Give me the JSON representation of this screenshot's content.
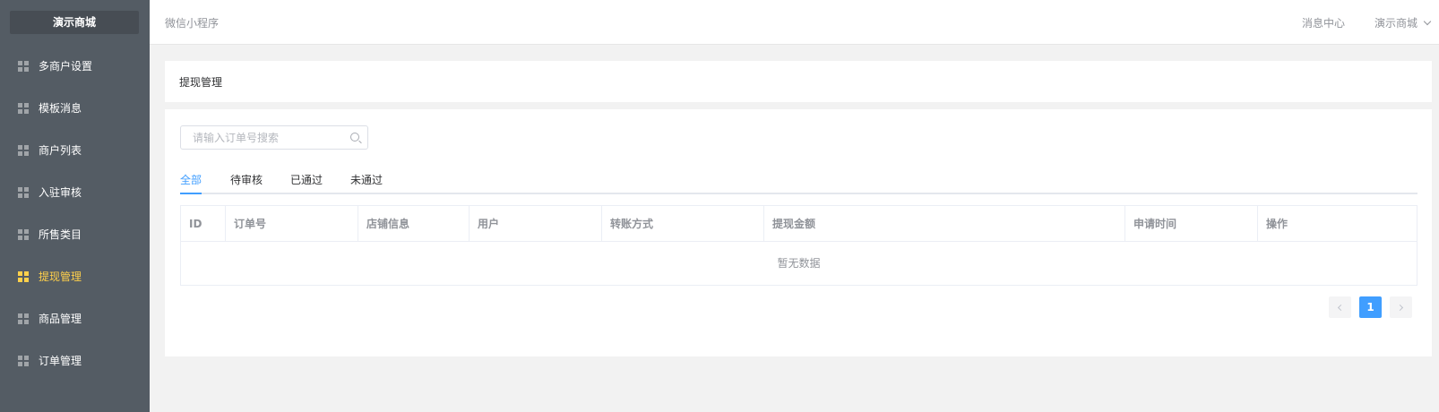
{
  "brand": "演示商城",
  "sidebar": {
    "items": [
      {
        "label": "多商户设置",
        "active": false
      },
      {
        "label": "模板消息",
        "active": false
      },
      {
        "label": "商户列表",
        "active": false
      },
      {
        "label": "入驻审核",
        "active": false
      },
      {
        "label": "所售类目",
        "active": false
      },
      {
        "label": "提现管理",
        "active": true
      },
      {
        "label": "商品管理",
        "active": false
      },
      {
        "label": "订单管理",
        "active": false
      }
    ]
  },
  "header": {
    "title": "微信小程序",
    "messages": "消息中心",
    "user": "演示商城"
  },
  "page": {
    "title": "提现管理"
  },
  "search": {
    "placeholder": "请输入订单号搜索"
  },
  "tabs": [
    {
      "label": "全部",
      "active": true
    },
    {
      "label": "待审核",
      "active": false
    },
    {
      "label": "已通过",
      "active": false
    },
    {
      "label": "未通过",
      "active": false
    }
  ],
  "table": {
    "columns": [
      "ID",
      "订单号",
      "店铺信息",
      "用户",
      "转账方式",
      "提现金额",
      "申请时间",
      "操作"
    ],
    "empty_text": "暂无数据"
  },
  "pagination": {
    "current": "1"
  },
  "colors": {
    "accent": "#409eff",
    "sidebar_bg": "#545c64",
    "sidebar_active": "#ffd04b"
  }
}
